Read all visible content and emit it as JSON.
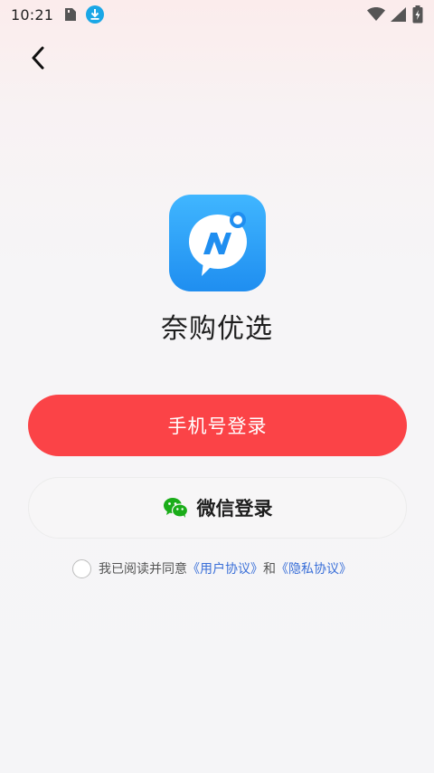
{
  "status_bar": {
    "time": "10:21",
    "left_icons": [
      "sim-card-icon",
      "download-icon"
    ],
    "right_icons": [
      "wifi-icon",
      "signal-icon",
      "battery-charging-icon"
    ]
  },
  "nav": {
    "back_icon": "chevron-left-icon"
  },
  "app": {
    "logo_icon": "app-logo-icon",
    "name": "奈购优选"
  },
  "login": {
    "phone_label": "手机号登录",
    "wechat_label": "微信登录",
    "wechat_icon": "wechat-icon"
  },
  "agreement": {
    "prefix": "我已阅读并同意",
    "user_agreement": "《用户协议》",
    "conjunction": "和",
    "privacy_policy": "《隐私协议》",
    "checked": false
  },
  "colors": {
    "primary": "#fb4347",
    "link": "#3a6fd8",
    "logo_blue": "#2b9cf6",
    "wechat_green": "#1aad19"
  }
}
